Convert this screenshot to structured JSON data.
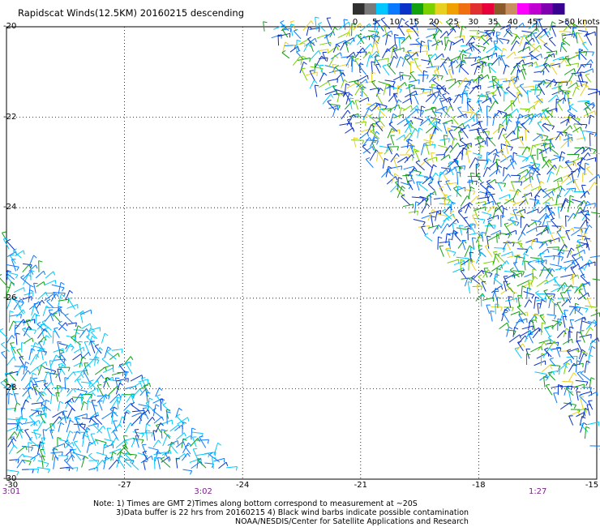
{
  "title": "Rapidscat Winds(12.5KM) 20160215 descending",
  "colorbar": {
    "tick_labels": [
      "0",
      "5",
      "10",
      "15",
      "20",
      "25",
      "30",
      "35",
      "40",
      "45",
      ">50 knots"
    ],
    "colors": [
      "#303030",
      "#7a7a7a",
      "#00c8ff",
      "#0a78ff",
      "#0a32c8",
      "#10a010",
      "#7ad000",
      "#e8d020",
      "#f0a000",
      "#f07010",
      "#e03030",
      "#e8003a",
      "#8a5a2a",
      "#c89060",
      "#ff00ff",
      "#c000d0",
      "#8000b0",
      "#3a0090"
    ]
  },
  "map": {
    "lat_range": [
      -30,
      -20
    ],
    "lon_range": [
      -30,
      -15
    ],
    "lat_labels": [
      "-20",
      "-22",
      "-24",
      "-26",
      "-28",
      "-30"
    ],
    "lon_labels": [
      "-30",
      "-27",
      "-24",
      "-21",
      "-18",
      "-15"
    ],
    "time_labels": [
      {
        "text": "3:01",
        "lon": -30
      },
      {
        "text": "3:02",
        "lon": -25
      },
      {
        "text": "1:27",
        "lon": -16.5
      }
    ]
  },
  "notes": {
    "line1": "Note: 1) Times are GMT 2)Times along bottom correspond to measurement at ~20S",
    "line2": "3)Data buffer is 22 hrs from 20160215 4) Black wind barbs indicate possible contamination",
    "line3": "NOAA/NESDIS/Center for Satellite Applications and Research"
  }
}
